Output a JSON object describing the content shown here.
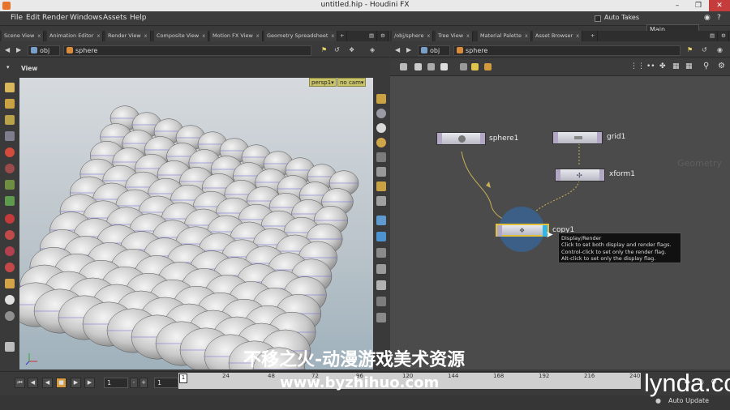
{
  "window": {
    "title": "untitled.hip - Houdini FX"
  },
  "menu": [
    "File",
    "Edit",
    "Render",
    "Windows",
    "Assets",
    "Help"
  ],
  "menubar_right": {
    "auto_takes": "Auto Takes",
    "desktop": "Main"
  },
  "left_tabs": [
    "Scene View",
    "Animation Editor",
    "Render View",
    "Composite View",
    "Motion FX View",
    "Geometry Spreadsheet"
  ],
  "right_tabs": [
    "/obj/sphere",
    "Tree View",
    "Material Palette",
    "Asset Browser"
  ],
  "left_path": {
    "root": "obj",
    "node": "sphere"
  },
  "right_path": {
    "root": "obj",
    "node": "sphere"
  },
  "view": {
    "label": "View",
    "camera": "persp1▾",
    "cam2": "no cam▾"
  },
  "network": {
    "context_label": "Geometry",
    "nodes": [
      {
        "name": "sphere1"
      },
      {
        "name": "grid1"
      },
      {
        "name": "xform1"
      },
      {
        "name": "copy1"
      }
    ],
    "tooltip": [
      "Display/Render",
      "Click to set both display and render flags.",
      "Control-click to set only the render flag.",
      "Alt-click to set only the display flag."
    ]
  },
  "timeline": {
    "start_frame": "1",
    "current_frame": "1",
    "current_marker": "1",
    "ticks": [
      "24",
      "48",
      "72",
      "96",
      "120",
      "144",
      "168",
      "192",
      "216",
      "240"
    ]
  },
  "status": {
    "auto_update": "Auto Update"
  },
  "watermarks": {
    "cn": "不移之火-动漫游戏美术资源",
    "url": "www.byzhihuo.com",
    "brand": "lynda.com"
  }
}
